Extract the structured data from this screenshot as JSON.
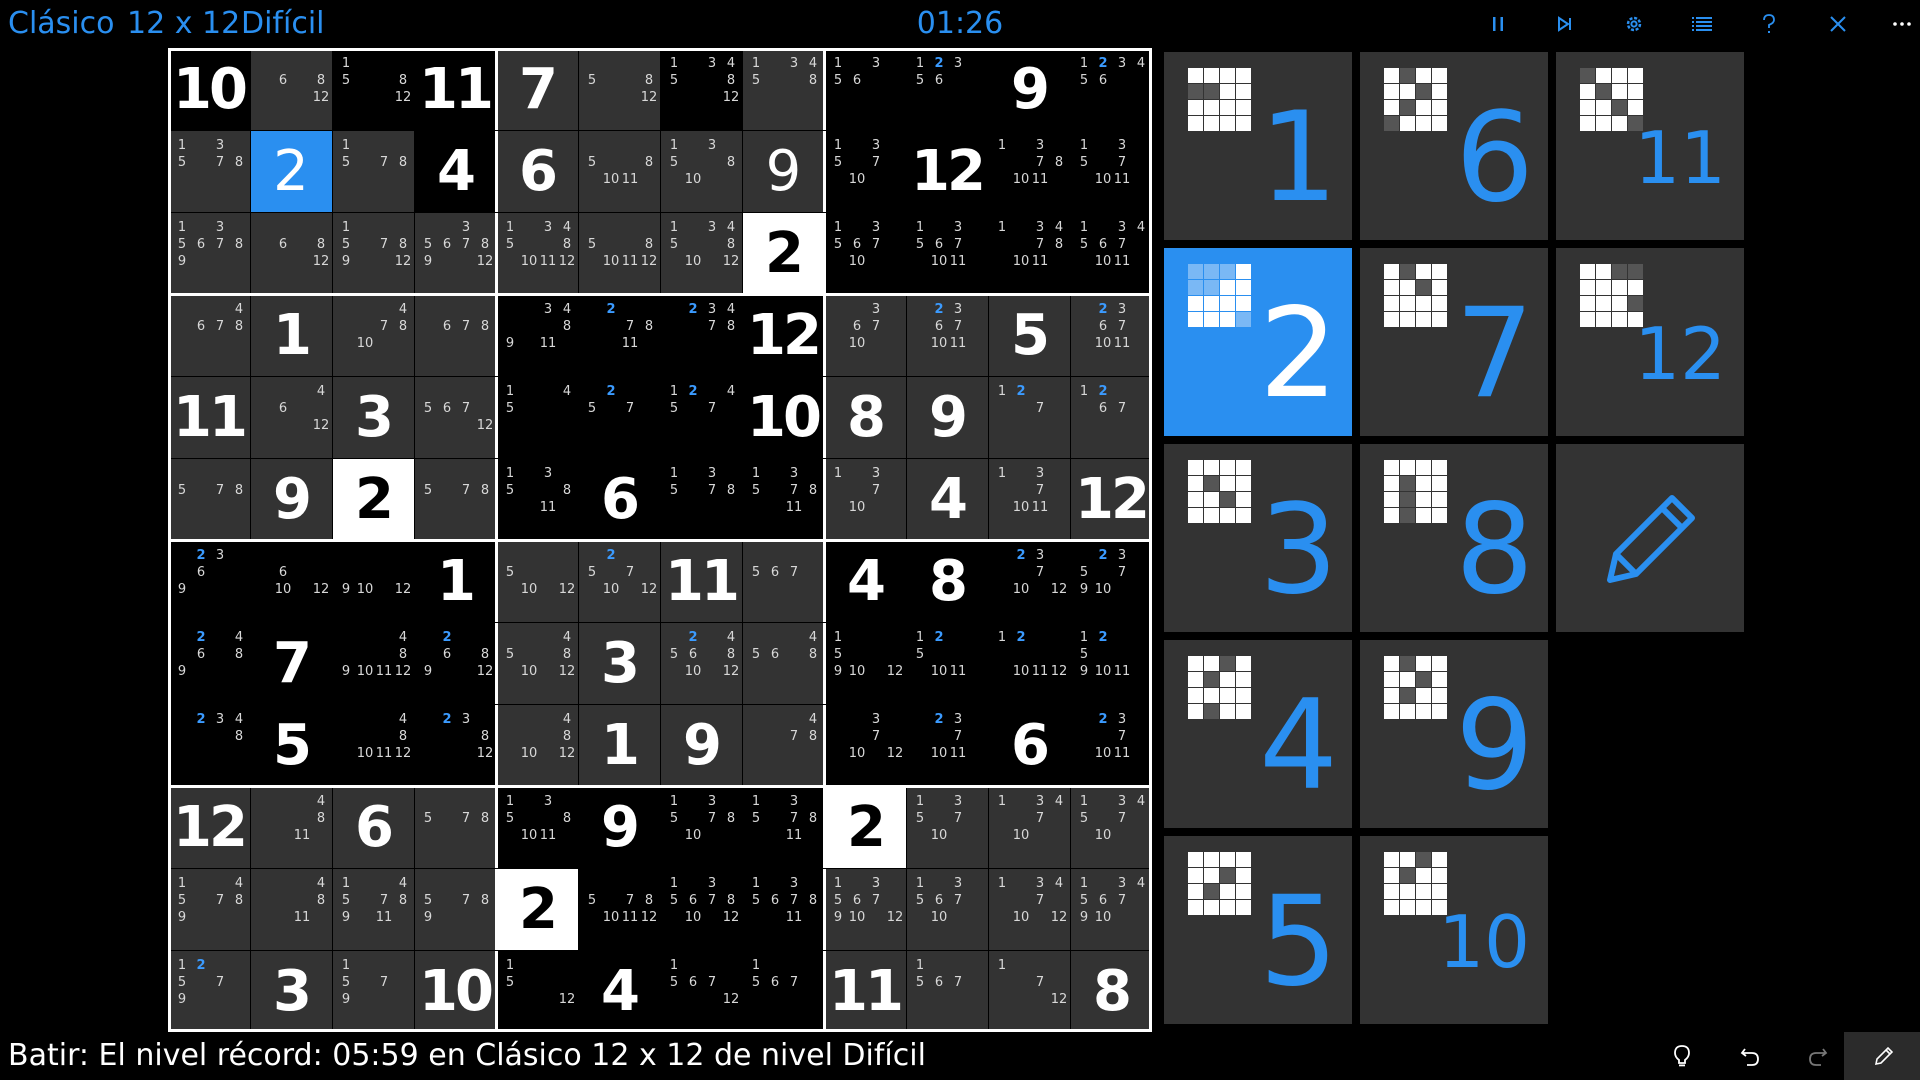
{
  "header": {
    "mode": "Clásico",
    "size": "12 x 12",
    "difficulty": "Difícil",
    "timer": "01:26"
  },
  "toolbar_icons": [
    "pause-icon",
    "skip-icon",
    "gear-icon",
    "list-icon",
    "help-icon",
    "close-icon",
    "more-icon"
  ],
  "colors": {
    "accent": "#2a8ff0",
    "given_cell": "#000000",
    "empty_cell": "#333333",
    "highlight_cell": "#ffffff",
    "tile": "#333333"
  },
  "board": {
    "rows": 12,
    "cols": 12,
    "grid": [
      [
        "10",
        "",
        "",
        "11",
        "7",
        "",
        "",
        "",
        "",
        "",
        "9",
        ""
      ],
      [
        "",
        "2",
        "",
        "4",
        "6",
        "",
        "",
        "9",
        "",
        "12",
        "",
        ""
      ],
      [
        "",
        "",
        "",
        "",
        "",
        "",
        "",
        "2",
        "",
        "",
        "",
        ""
      ],
      [
        "",
        "1",
        "",
        "",
        "",
        "",
        "",
        "12",
        "",
        "",
        "5",
        ""
      ],
      [
        "11",
        "",
        "3",
        "",
        "",
        "",
        "",
        "10",
        "8",
        "9",
        "",
        ""
      ],
      [
        "",
        "9",
        "2",
        "",
        "",
        "6",
        "",
        "",
        "",
        "4",
        "",
        "12"
      ],
      [
        "",
        "",
        "",
        "1",
        "",
        "",
        "11",
        "",
        "4",
        "8",
        "",
        ""
      ],
      [
        "",
        "7",
        "",
        "",
        "",
        "3",
        "",
        "",
        "",
        "",
        "",
        ""
      ],
      [
        "",
        "5",
        "",
        "",
        "",
        "1",
        "9",
        "",
        "",
        "",
        "6",
        ""
      ],
      [
        "12",
        "",
        "6",
        "",
        "",
        "9",
        "",
        "",
        "2",
        "",
        "",
        ""
      ],
      [
        "",
        "",
        "",
        "",
        "2",
        "",
        "",
        "",
        "",
        "",
        "",
        ""
      ],
      [
        "",
        "3",
        "",
        "10",
        "",
        "4",
        "",
        "",
        "11",
        "",
        "",
        "8"
      ]
    ],
    "cell_styles": [
      [
        "g",
        "e",
        "g",
        "g",
        "e",
        "e",
        "g",
        "e",
        "g",
        "g",
        "g",
        "g"
      ],
      [
        "e",
        "blue",
        "e",
        "g",
        "e",
        "e",
        "e",
        "e",
        "g",
        "g",
        "g",
        "g"
      ],
      [
        "e",
        "e",
        "e",
        "e",
        "e",
        "e",
        "e",
        "white",
        "g",
        "g",
        "g",
        "g"
      ],
      [
        "e",
        "e",
        "e",
        "e",
        "g",
        "g",
        "g",
        "g",
        "e",
        "e",
        "e",
        "e"
      ],
      [
        "e",
        "e",
        "e",
        "e",
        "g",
        "g",
        "g",
        "g",
        "e",
        "e",
        "e",
        "e"
      ],
      [
        "e",
        "e",
        "white",
        "e",
        "g",
        "g",
        "g",
        "g",
        "e",
        "e",
        "e",
        "e"
      ],
      [
        "g",
        "g",
        "g",
        "g",
        "e",
        "e",
        "e",
        "e",
        "g",
        "g",
        "g",
        "g"
      ],
      [
        "g",
        "g",
        "g",
        "g",
        "e",
        "e",
        "e",
        "e",
        "g",
        "g",
        "g",
        "g"
      ],
      [
        "g",
        "g",
        "g",
        "g",
        "e",
        "e",
        "e",
        "e",
        "g",
        "g",
        "g",
        "g"
      ],
      [
        "e",
        "e",
        "e",
        "e",
        "g",
        "g",
        "g",
        "g",
        "white",
        "e",
        "e",
        "e"
      ],
      [
        "e",
        "e",
        "e",
        "e",
        "white",
        "g",
        "g",
        "g",
        "e",
        "e",
        "e",
        "e"
      ],
      [
        "e",
        "e",
        "e",
        "e",
        "g",
        "g",
        "g",
        "g",
        "e",
        "e",
        "e",
        "e"
      ]
    ],
    "thin_values": [
      [
        1,
        7
      ]
    ],
    "notes": [
      [
        [],
        [
          "6",
          "8",
          "12"
        ],
        [
          "1",
          "5",
          "8",
          "12"
        ],
        [],
        [],
        [
          "5",
          "8",
          "12"
        ],
        [
          "1",
          "3",
          "4",
          "5",
          "8",
          "12"
        ],
        [
          "1",
          "3",
          "4",
          "5",
          "8"
        ],
        [
          "1",
          "3",
          "5",
          "6"
        ],
        [
          "1",
          "2",
          "3",
          "5",
          "6"
        ],
        [],
        [
          "1",
          "2",
          "3",
          "4",
          "5",
          "6"
        ]
      ],
      [
        [
          "1",
          "3",
          "5",
          "7",
          "8"
        ],
        [],
        [
          "1",
          "5",
          "7",
          "8"
        ],
        [],
        [],
        [
          "5",
          "8",
          "10",
          "11"
        ],
        [
          "1",
          "3",
          "5",
          "8",
          "10"
        ],
        [],
        [
          "1",
          "3",
          "5",
          "7",
          "10"
        ],
        [],
        [
          "1",
          "3",
          "7",
          "8",
          "10",
          "11"
        ],
        [
          "1",
          "3",
          "5",
          "7",
          "10",
          "11"
        ]
      ],
      [
        [
          "1",
          "3",
          "5",
          "6",
          "7",
          "8",
          "9"
        ],
        [
          "6",
          "8",
          "12"
        ],
        [
          "1",
          "5",
          "7",
          "8",
          "9",
          "12"
        ],
        [
          "3",
          "5",
          "6",
          "7",
          "8",
          "9",
          "12"
        ],
        [
          "1",
          "3",
          "4",
          "5",
          "8",
          "10",
          "11",
          "12"
        ],
        [
          "5",
          "8",
          "10",
          "11",
          "12"
        ],
        [
          "1",
          "3",
          "4",
          "5",
          "8",
          "10",
          "12"
        ],
        [],
        [
          "1",
          "3",
          "5",
          "6",
          "7",
          "10"
        ],
        [
          "1",
          "3",
          "5",
          "6",
          "7",
          "10",
          "11"
        ],
        [
          "1",
          "3",
          "4",
          "7",
          "8",
          "10",
          "11"
        ],
        [
          "1",
          "3",
          "4",
          "5",
          "6",
          "7",
          "10",
          "11"
        ]
      ],
      [
        [
          "4",
          "6",
          "7",
          "8"
        ],
        [],
        [
          "4",
          "7",
          "8",
          "10"
        ],
        [
          "6",
          "7",
          "8"
        ],
        [
          "3",
          "4",
          "8",
          "9",
          "11"
        ],
        [
          "2",
          "7",
          "8",
          "11"
        ],
        [
          "2",
          "3",
          "4",
          "7",
          "8"
        ],
        [],
        [
          "3",
          "6",
          "7",
          "10"
        ],
        [
          "2",
          "3",
          "6",
          "7",
          "10",
          "11"
        ],
        [],
        [
          "2",
          "3",
          "6",
          "7",
          "10",
          "11"
        ]
      ],
      [
        [],
        [
          "4",
          "6",
          "12"
        ],
        [],
        [
          "5",
          "6",
          "7",
          "12"
        ],
        [
          "1",
          "4",
          "5"
        ],
        [
          "2",
          "5",
          "7"
        ],
        [
          "1",
          "2",
          "4",
          "5",
          "7"
        ],
        [],
        [],
        [],
        [
          "1",
          "2",
          "7"
        ],
        [
          "1",
          "2",
          "6",
          "7"
        ]
      ],
      [
        [
          "5",
          "7",
          "8"
        ],
        [],
        [],
        [
          "5",
          "7",
          "8"
        ],
        [
          "1",
          "3",
          "5",
          "8",
          "11"
        ],
        [],
        [
          "1",
          "3",
          "5",
          "7",
          "8"
        ],
        [
          "1",
          "3",
          "5",
          "7",
          "8",
          "11"
        ],
        [
          "1",
          "3",
          "7",
          "10"
        ],
        [],
        [
          "1",
          "3",
          "7",
          "10",
          "11"
        ],
        []
      ],
      [
        [
          "2",
          "3",
          "6",
          "9"
        ],
        [
          "6",
          "10",
          "12"
        ],
        [
          "9",
          "10",
          "12"
        ],
        [],
        [
          "5",
          "10",
          "12"
        ],
        [
          "2",
          "5",
          "7",
          "10",
          "12"
        ],
        [],
        [
          "5",
          "6",
          "7"
        ],
        [],
        [],
        [
          "2",
          "3",
          "7",
          "10",
          "12"
        ],
        [
          "2",
          "3",
          "5",
          "7",
          "9",
          "10"
        ]
      ],
      [
        [
          "2",
          "4",
          "6",
          "8",
          "9"
        ],
        [],
        [
          "4",
          "8",
          "9",
          "10",
          "11",
          "12"
        ],
        [
          "2",
          "6",
          "8",
          "9",
          "12"
        ],
        [
          "4",
          "5",
          "8",
          "10",
          "12"
        ],
        [],
        [
          "2",
          "4",
          "5",
          "6",
          "8",
          "10",
          "12"
        ],
        [
          "4",
          "5",
          "6",
          "8"
        ],
        [
          "1",
          "5",
          "9",
          "10",
          "12"
        ],
        [
          "1",
          "2",
          "5",
          "10",
          "11"
        ],
        [
          "1",
          "2",
          "10",
          "11",
          "12"
        ],
        [
          "1",
          "2",
          "5",
          "9",
          "10",
          "11"
        ]
      ],
      [
        [
          "2",
          "3",
          "4",
          "8"
        ],
        [],
        [
          "4",
          "8",
          "10",
          "11",
          "12"
        ],
        [
          "2",
          "3",
          "8",
          "12"
        ],
        [
          "4",
          "8",
          "10",
          "12"
        ],
        [],
        [],
        [
          "4",
          "7",
          "8"
        ],
        [
          "3",
          "7",
          "10",
          "12"
        ],
        [
          "2",
          "3",
          "7",
          "10",
          "11"
        ],
        [],
        [
          "2",
          "3",
          "7",
          "10",
          "11"
        ]
      ],
      [
        [],
        [
          "4",
          "8",
          "11"
        ],
        [],
        [
          "5",
          "7",
          "8"
        ],
        [
          "1",
          "3",
          "5",
          "8",
          "10",
          "11"
        ],
        [],
        [
          "1",
          "3",
          "5",
          "7",
          "8",
          "10"
        ],
        [
          "1",
          "3",
          "5",
          "7",
          "8",
          "11"
        ],
        [],
        [
          "1",
          "3",
          "5",
          "7",
          "10"
        ],
        [
          "1",
          "3",
          "4",
          "7",
          "10"
        ],
        [
          "1",
          "3",
          "4",
          "5",
          "7",
          "10"
        ]
      ],
      [
        [
          "1",
          "4",
          "5",
          "7",
          "8",
          "9"
        ],
        [
          "4",
          "8",
          "11"
        ],
        [
          "1",
          "4",
          "5",
          "7",
          "8",
          "9",
          "11"
        ],
        [
          "5",
          "7",
          "8",
          "9"
        ],
        [],
        [
          "5",
          "7",
          "8",
          "10",
          "11",
          "12"
        ],
        [
          "1",
          "3",
          "5",
          "6",
          "7",
          "8",
          "10",
          "12"
        ],
        [
          "1",
          "3",
          "5",
          "6",
          "7",
          "8",
          "11"
        ],
        [
          "1",
          "3",
          "5",
          "6",
          "7",
          "9",
          "10",
          "12"
        ],
        [
          "1",
          "3",
          "5",
          "6",
          "7",
          "10"
        ],
        [
          "1",
          "3",
          "4",
          "7",
          "10",
          "12"
        ],
        [
          "1",
          "3",
          "4",
          "5",
          "6",
          "7",
          "9",
          "10"
        ]
      ],
      [
        [
          "1",
          "2",
          "5",
          "7",
          "9"
        ],
        [],
        [
          "1",
          "5",
          "7",
          "9"
        ],
        [],
        [
          "1",
          "5",
          "12"
        ],
        [],
        [
          "1",
          "5",
          "6",
          "7",
          "12"
        ],
        [
          "1",
          "5",
          "6",
          "7"
        ],
        [],
        [
          "1",
          "5",
          "6",
          "7"
        ],
        [
          "1",
          "7",
          "12"
        ],
        []
      ]
    ]
  },
  "number_tiles": [
    {
      "label": "1",
      "size": "big",
      "selected": false,
      "pattern": [
        1,
        1,
        1,
        1,
        0,
        0,
        1,
        1,
        1,
        1,
        1,
        1,
        1,
        1,
        1,
        1
      ]
    },
    {
      "label": "6",
      "size": "big",
      "selected": false,
      "pattern": [
        1,
        0,
        1,
        1,
        1,
        1,
        0,
        1,
        1,
        0,
        1,
        1,
        0,
        1,
        1,
        1
      ]
    },
    {
      "label": "11",
      "size": "mid",
      "selected": false,
      "pattern": [
        0,
        1,
        1,
        1,
        1,
        0,
        1,
        1,
        1,
        1,
        0,
        1,
        1,
        1,
        1,
        0
      ]
    },
    {
      "label": "2",
      "size": "big",
      "selected": true,
      "pattern": [
        0,
        0,
        0,
        1,
        0,
        0,
        1,
        1,
        1,
        1,
        1,
        1,
        1,
        1,
        1,
        0
      ]
    },
    {
      "label": "7",
      "size": "big",
      "selected": false,
      "pattern": [
        1,
        0,
        1,
        1,
        1,
        1,
        0,
        1,
        1,
        1,
        1,
        1,
        1,
        1,
        1,
        1
      ]
    },
    {
      "label": "12",
      "size": "mid",
      "selected": false,
      "pattern": [
        1,
        1,
        0,
        0,
        1,
        1,
        1,
        1,
        1,
        1,
        1,
        0,
        1,
        1,
        1,
        1
      ]
    },
    {
      "label": "3",
      "size": "big",
      "selected": false,
      "pattern": [
        1,
        1,
        1,
        1,
        1,
        0,
        1,
        1,
        1,
        1,
        0,
        1,
        1,
        1,
        1,
        1
      ]
    },
    {
      "label": "8",
      "size": "big",
      "selected": false,
      "pattern": [
        1,
        1,
        1,
        1,
        1,
        0,
        1,
        1,
        1,
        0,
        1,
        1,
        1,
        0,
        1,
        1
      ]
    },
    {
      "label": "4",
      "size": "big",
      "selected": false,
      "pattern": [
        1,
        1,
        0,
        1,
        1,
        0,
        1,
        1,
        1,
        1,
        1,
        1,
        1,
        0,
        1,
        1
      ]
    },
    {
      "label": "9",
      "size": "big",
      "selected": false,
      "pattern": [
        1,
        0,
        1,
        1,
        1,
        1,
        0,
        1,
        1,
        0,
        1,
        1,
        1,
        1,
        1,
        1
      ]
    },
    {
      "label": "5",
      "size": "big",
      "selected": false,
      "pattern": [
        1,
        1,
        1,
        1,
        1,
        1,
        0,
        1,
        1,
        0,
        1,
        1,
        1,
        1,
        1,
        1
      ]
    },
    {
      "label": "10",
      "size": "mid",
      "selected": false,
      "pattern": [
        1,
        1,
        0,
        1,
        1,
        0,
        1,
        1,
        1,
        1,
        1,
        1,
        1,
        1,
        1,
        1
      ]
    }
  ],
  "status": {
    "text": "Batir: El nivel récord: 05:59 en Clásico 12 x 12 de nivel Difícil"
  },
  "bottom_icons": [
    "lightbulb-icon",
    "undo-icon",
    "redo-icon",
    "pencil-icon"
  ]
}
